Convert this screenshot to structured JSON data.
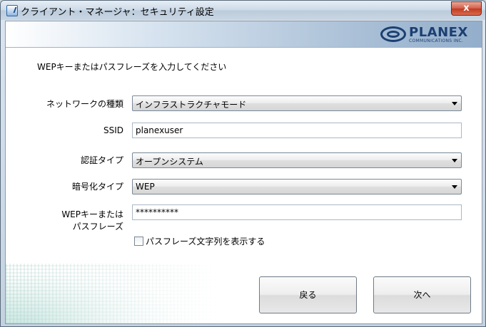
{
  "window": {
    "title": "クライアント・マネージャ：セキュリティ設定",
    "close_label": "x"
  },
  "logo": {
    "name": "PLANEX",
    "sub": "COMMUNICATIONS INC."
  },
  "instruction": "WEPキーまたはパスフレーズを入力してください",
  "form": {
    "network_type": {
      "label": "ネットワークの種類",
      "value": "インフラストラクチャモード"
    },
    "ssid": {
      "label": "SSID",
      "value": "planexuser"
    },
    "auth_type": {
      "label": "認証タイプ",
      "value": "オープンシステム"
    },
    "encryption_type": {
      "label": "暗号化タイプ",
      "value": "WEP"
    },
    "wep_key": {
      "label_line1": "WEPキーまたは",
      "label_line2": "パスフレーズ",
      "value": "**********"
    },
    "show_passphrase": {
      "label": "パスフレーズ文字列を表示する",
      "checked": false
    }
  },
  "buttons": {
    "back": "戻る",
    "next": "次へ"
  }
}
